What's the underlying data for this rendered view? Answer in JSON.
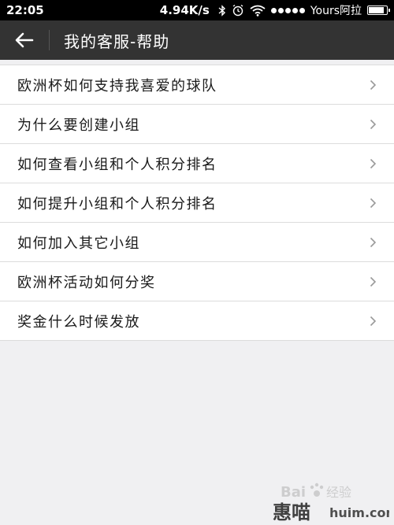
{
  "status_bar": {
    "time": "22:05",
    "network_speed": "4.94K/s",
    "carrier": "Yours阿拉",
    "icons": [
      "bluetooth-icon",
      "alarm-icon",
      "wifi-icon",
      "signal-icon",
      "battery-icon"
    ],
    "battery_level": 0.9
  },
  "header": {
    "back_icon": "back-arrow-icon",
    "title": "我的客服-帮助",
    "background": "#333333"
  },
  "help_list": {
    "items": [
      {
        "label": "欧洲杯如何支持我喜爱的球队"
      },
      {
        "label": "为什么要创建小组"
      },
      {
        "label": "如何查看小组和个人积分排名"
      },
      {
        "label": "如何提升小组和个人积分排名"
      },
      {
        "label": "如何加入其它小组"
      },
      {
        "label": "欧洲杯活动如何分奖"
      },
      {
        "label": "奖金什么时候发放"
      }
    ],
    "chevron_icon": "chevron-right-icon"
  },
  "watermark": {
    "logo_text_top": "Bai",
    "logo_text_top2": "经验",
    "logo_text_bottom": "惠喵",
    "url": "huim.com"
  }
}
